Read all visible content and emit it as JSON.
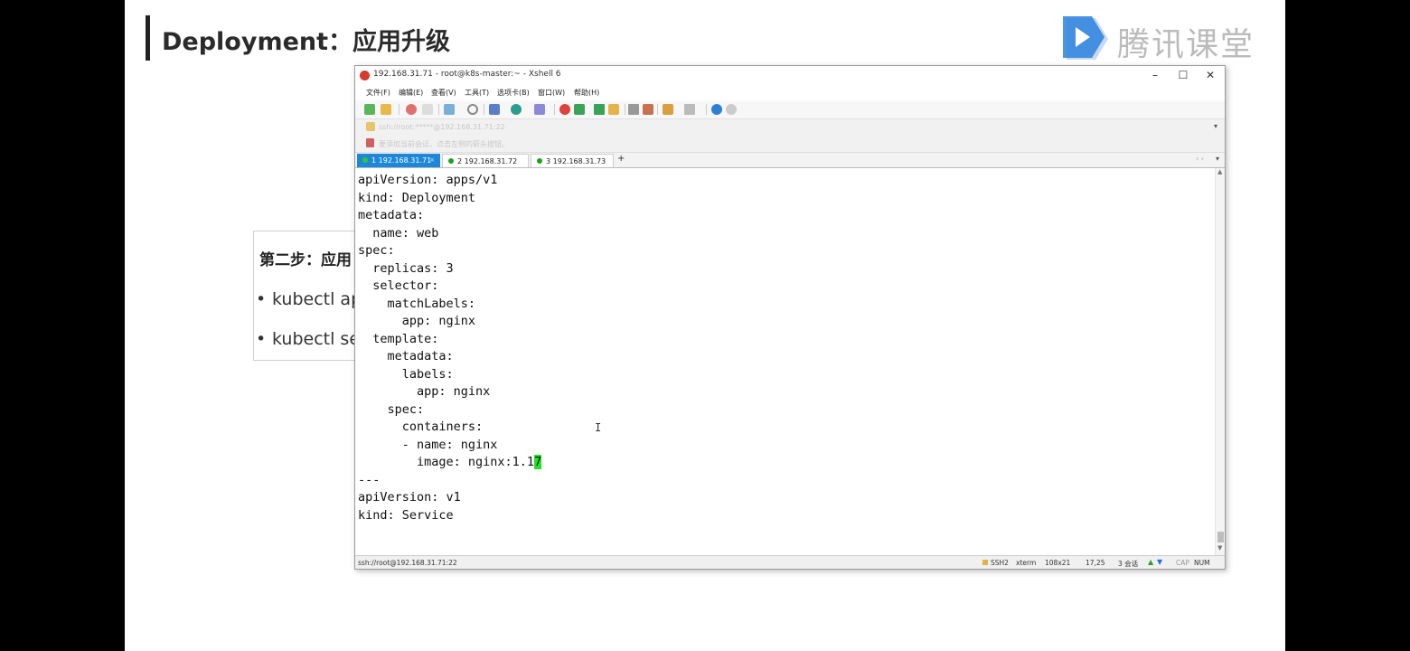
{
  "slide": {
    "title": "Deployment：应用升级",
    "logo_text": "腾讯课堂",
    "step_heading": "第二步：应用",
    "bullets": [
      "kubectl ap",
      "kubectl se"
    ]
  },
  "window": {
    "title": "192.168.31.71 - root@k8s-master:~ - Xshell 6",
    "controls": [
      "–",
      "☐",
      "✕"
    ],
    "menu": [
      "文件(F)",
      "编辑(E)",
      "查看(V)",
      "工具(T)",
      "选项卡(B)",
      "窗口(W)",
      "帮助(H)"
    ],
    "address": "ssh://root:*****@192.168.31.71:22",
    "hint": "要添加当前会话，点击左侧的箭头按钮。",
    "tabs": [
      {
        "label": "1 192.168.31.71",
        "status_color": "#32c832"
      },
      {
        "label": "2 192.168.31.72",
        "status_color": "#1aa31a"
      },
      {
        "label": "3 192.168.31.73",
        "status_color": "#1aa31a"
      }
    ],
    "add_tab": "+"
  },
  "terminal": {
    "lines": [
      "apiVersion: apps/v1",
      "kind: Deployment",
      "metadata:",
      "  name: web",
      "spec:",
      "  replicas: 3",
      "  selector:",
      "    matchLabels:",
      "      app: nginx",
      "  template:",
      "    metadata:",
      "      labels:",
      "        app: nginx",
      "    spec:",
      "      containers:",
      "      - name: nginx",
      "        image: nginx:1.1",
      "---",
      "apiVersion: v1",
      "kind: Service"
    ],
    "cursor_char": "7",
    "cursor_line_index": 16
  },
  "status": {
    "connection": "ssh://root@192.168.31.71:22",
    "protocol": "SSH2",
    "terminal_type": "xterm",
    "size": "108x21",
    "position": "17,25",
    "sessions": "3 会话",
    "cap": "CAP",
    "num": "NUM"
  }
}
